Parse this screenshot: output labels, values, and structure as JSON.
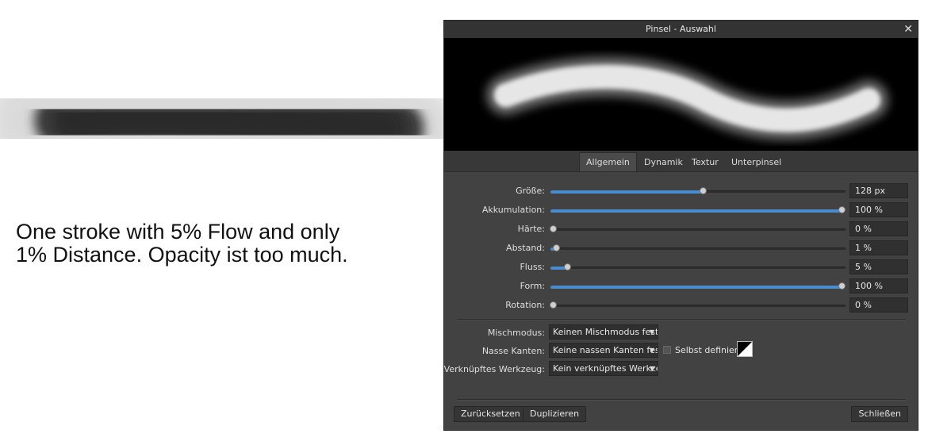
{
  "annotation": {
    "lines": [
      "One stroke with 5% Flow and only",
      "1% Distance. Opacity ist too much."
    ]
  },
  "dialog": {
    "title": "Pinsel - Auswahl",
    "close_glyph": "✕",
    "tabs": [
      "Allgemein",
      "Dynamik",
      "Textur",
      "Unterpinsel"
    ],
    "active_tab": "Allgemein",
    "sliders": [
      {
        "label": "Größe:",
        "value": "128 px",
        "fraction": 0.52
      },
      {
        "label": "Akkumulation:",
        "value": "100 %",
        "fraction": 1.0
      },
      {
        "label": "Härte:",
        "value": "0 %",
        "fraction": 0.0
      },
      {
        "label": "Abstand:",
        "value": "1 %",
        "fraction": 0.01
      },
      {
        "label": "Fluss:",
        "value": "5 %",
        "fraction": 0.05
      },
      {
        "label": "Form:",
        "value": "100 %",
        "fraction": 1.0
      },
      {
        "label": "Rotation:",
        "value": "0 %",
        "fraction": 0.0
      }
    ],
    "blend_mode": {
      "label": "Mischmodus:",
      "value": "Keinen Mischmodus festl"
    },
    "wet_edges": {
      "label": "Nasse Kanten:",
      "value": "Keine nassen Kanten fest",
      "custom_label": "Selbst definiert"
    },
    "linked_tool": {
      "label": "Verknüpftes Werkzeug:",
      "value": "Kein verknüpftes Werkze"
    },
    "buttons": {
      "reset": "Zurücksetzen",
      "duplicate": "Duplizieren",
      "close": "Schließen"
    },
    "accent_color": "#4a8cd0"
  }
}
